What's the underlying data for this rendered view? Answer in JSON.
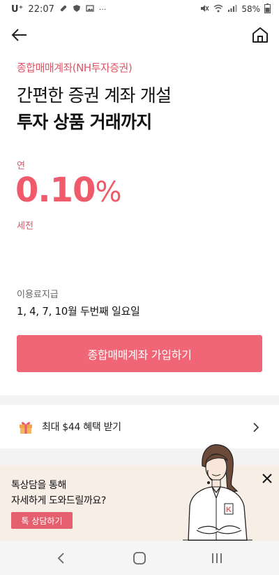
{
  "status": {
    "carrier": "U⁺",
    "time": "22:07",
    "battery": "58%",
    "notif_icons": [
      "pill-icon",
      "shield-icon",
      "image-icon",
      "more-dots-icon"
    ],
    "more_dots": "···"
  },
  "header": {
    "product_label": "종합매매계좌(NH투자증권)",
    "headline_line1": "간편한 증권 계좌 개설",
    "headline_line2": "투자 상품 거래까지"
  },
  "rate": {
    "prefix": "연",
    "value": "0.10",
    "unit": "%",
    "suffix": "세전"
  },
  "payment": {
    "label": "이용료지급",
    "value": "1, 4, 7, 10월 두번째 일요일"
  },
  "join_button": {
    "label": "종합매매계좌 가입하기"
  },
  "benefit": {
    "label": "최대 $44 혜택 받기"
  },
  "chat_banner": {
    "line1": "톡상담을 통해",
    "line2": "자세하게 도와드릴까요?",
    "button": "톡 상담하기",
    "badge_letter": "K"
  },
  "colors": {
    "accent": "#ef5b6a",
    "button": "#f06676",
    "banner_bg": "#f7eee6"
  }
}
